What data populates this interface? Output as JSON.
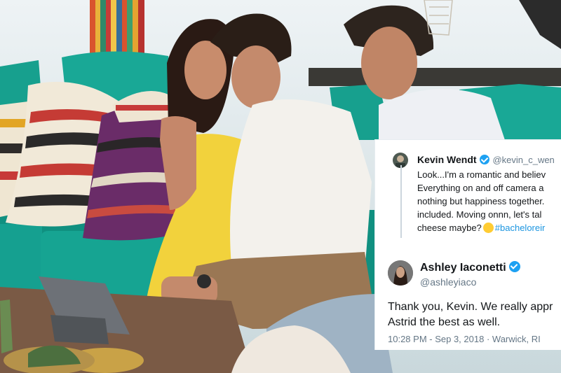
{
  "photo": {
    "subject": "photo-scene"
  },
  "tweet": {
    "name": "Kevin Wendt",
    "handle": "@kevin_c_wen",
    "lines": [
      "Look...I'm a romantic and believ",
      "Everything on and off camera a",
      "nothing but happiness together.",
      "included. Moving onnn, let's tal",
      "cheese maybe?"
    ],
    "hashtag": "#bacheloreir",
    "emoji": "upside-down-face-emoji"
  },
  "reply": {
    "name": "Ashley Iaconetti",
    "handle": "@ashleyiaco",
    "lines": [
      "Thank you, Kevin. We really appr",
      "Astrid the best as well."
    ],
    "timestamp": "10:28 PM - Sep 3, 2018",
    "separator": "·",
    "location": "Warwick, RI"
  },
  "colors": {
    "twitter_blue": "#1da1f2",
    "hashtag": "#1b95e0",
    "muted": "#657786"
  }
}
